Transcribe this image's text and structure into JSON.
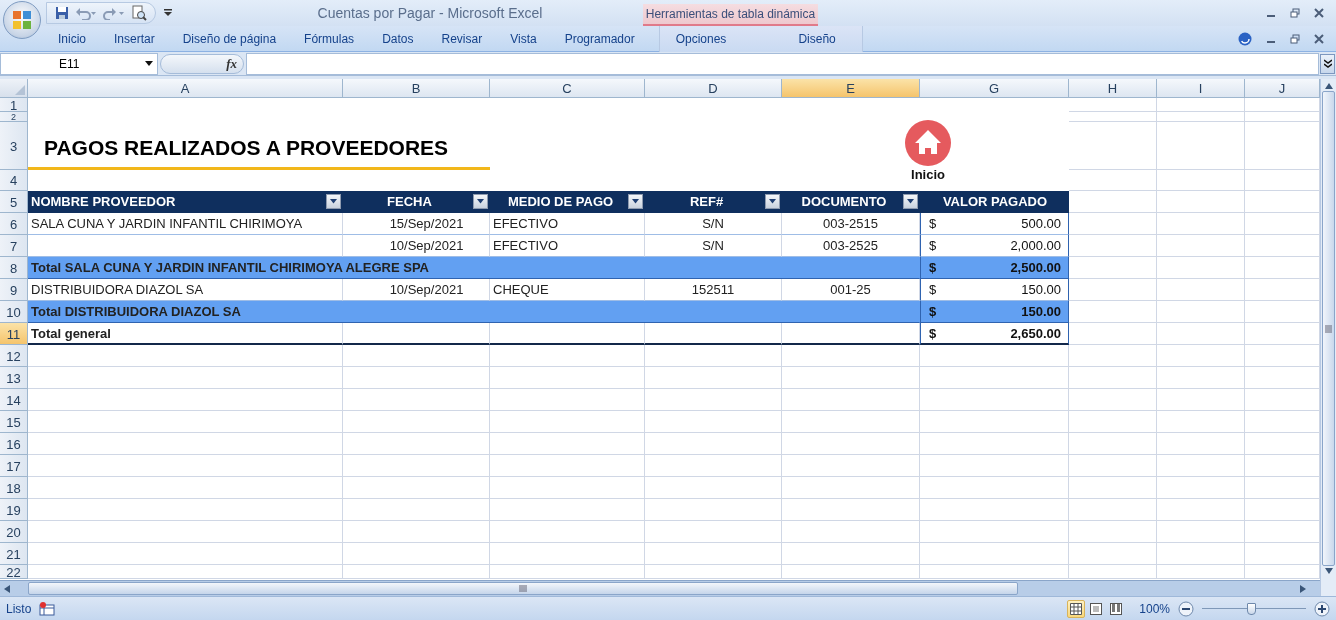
{
  "window": {
    "title": "Cuentas por Pagar - Microsoft Excel",
    "contextual_tab": "Herramientas de tabla dinámica"
  },
  "ribbon_tabs": [
    {
      "label": "Inicio"
    },
    {
      "label": "Insertar"
    },
    {
      "label": "Diseño de página"
    },
    {
      "label": "Fórmulas"
    },
    {
      "label": "Datos"
    },
    {
      "label": "Revisar"
    },
    {
      "label": "Vista"
    },
    {
      "label": "Programador"
    }
  ],
  "contextual_tabs": [
    {
      "label": "Opciones"
    },
    {
      "label": "Diseño"
    }
  ],
  "formula_bar": {
    "name_box": "E11",
    "function_label": "fx"
  },
  "columns": [
    {
      "label": "A",
      "selected": false
    },
    {
      "label": "B",
      "selected": false
    },
    {
      "label": "C",
      "selected": false
    },
    {
      "label": "D",
      "selected": false
    },
    {
      "label": "E",
      "selected": true
    },
    {
      "label": "G",
      "selected": false
    },
    {
      "label": "H",
      "selected": false
    },
    {
      "label": "I",
      "selected": false
    },
    {
      "label": "J",
      "selected": false
    }
  ],
  "rows": [
    {
      "label": "1",
      "selected": false
    },
    {
      "label": "2",
      "selected": false
    },
    {
      "label": "3",
      "selected": false
    },
    {
      "label": "4",
      "selected": false
    },
    {
      "label": "5",
      "selected": false
    },
    {
      "label": "6",
      "selected": false
    },
    {
      "label": "7",
      "selected": false
    },
    {
      "label": "8",
      "selected": false
    },
    {
      "label": "9",
      "selected": false
    },
    {
      "label": "10",
      "selected": false
    },
    {
      "label": "11",
      "selected": true
    },
    {
      "label": "12",
      "selected": false
    },
    {
      "label": "13",
      "selected": false
    },
    {
      "label": "14",
      "selected": false
    },
    {
      "label": "15",
      "selected": false
    },
    {
      "label": "16",
      "selected": false
    },
    {
      "label": "17",
      "selected": false
    },
    {
      "label": "18",
      "selected": false
    },
    {
      "label": "19",
      "selected": false
    },
    {
      "label": "20",
      "selected": false
    },
    {
      "label": "21",
      "selected": false
    },
    {
      "label": "22",
      "selected": false
    }
  ],
  "sheet": {
    "title": "PAGOS REALIZADOS A PROVEEDORES",
    "home_button": "Inicio",
    "table": {
      "columns": [
        {
          "label": "NOMBRE PROVEEDOR",
          "filter": true
        },
        {
          "label": "FECHA",
          "filter": true
        },
        {
          "label": "MEDIO DE PAGO",
          "filter": true
        },
        {
          "label": "REF#",
          "filter": true
        },
        {
          "label": "DOCUMENTO",
          "filter": true
        },
        {
          "label": "VALOR PAGADO",
          "filter": false
        }
      ],
      "rows": [
        {
          "kind": "data",
          "cells": [
            "SALA CUNA Y JARDIN INFANTIL CHIRIMOYA",
            "15/Sep/2021",
            "EFECTIVO",
            "S/N",
            "003-2515"
          ],
          "currency": "$",
          "amount": "500.00"
        },
        {
          "kind": "data",
          "cells": [
            null,
            "10/Sep/2021",
            "EFECTIVO",
            "S/N",
            "003-2525"
          ],
          "currency": "$",
          "amount": "2,000.00"
        },
        {
          "kind": "subtotal",
          "label": "Total SALA CUNA Y JARDIN INFANTIL CHIRIMOYA ALEGRE SPA",
          "currency": "$",
          "amount": "2,500.00"
        },
        {
          "kind": "data",
          "cells": [
            "DISTRIBUIDORA DIAZOL SA",
            "10/Sep/2021",
            "CHEQUE",
            "152511",
            "001-25"
          ],
          "currency": "$",
          "amount": "150.00"
        },
        {
          "kind": "subtotal",
          "label": "Total DISTRIBUIDORA DIAZOL SA",
          "currency": "$",
          "amount": "150.00"
        },
        {
          "kind": "grand_total",
          "label": "Total general",
          "currency": "$",
          "amount": "2,650.00"
        }
      ]
    }
  },
  "status_bar": {
    "status": "Listo",
    "views": [
      {
        "kind": "normal",
        "selected": true
      },
      {
        "kind": "page_layout",
        "selected": false
      },
      {
        "kind": "page_break",
        "selected": false
      }
    ],
    "zoom": "100%",
    "zoom_slider": {
      "level": 0.47
    }
  }
}
